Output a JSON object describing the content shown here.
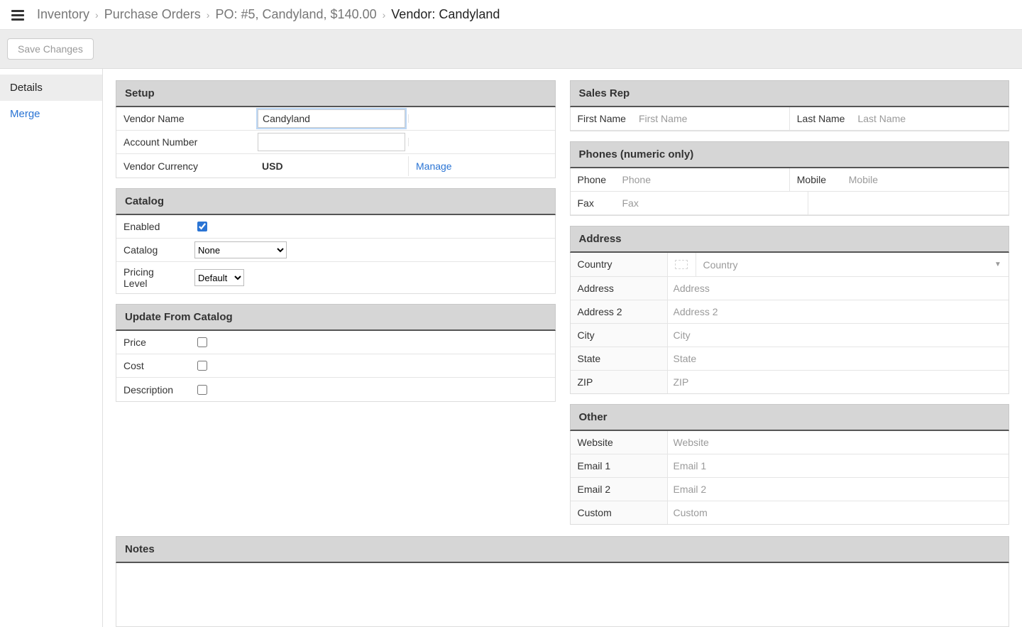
{
  "breadcrumb": {
    "items": [
      "Inventory",
      "Purchase Orders",
      "PO: #5, Candyland, $140.00",
      "Vendor: Candyland"
    ]
  },
  "toolbar": {
    "save_label": "Save Changes"
  },
  "sidebar": {
    "details": "Details",
    "merge": "Merge"
  },
  "setup": {
    "header": "Setup",
    "vendor_name_label": "Vendor Name",
    "vendor_name_value": "Candyland",
    "account_number_label": "Account Number",
    "account_number_value": "",
    "vendor_currency_label": "Vendor Currency",
    "vendor_currency_value": "USD",
    "manage_label": "Manage"
  },
  "catalog": {
    "header": "Catalog",
    "enabled_label": "Enabled",
    "enabled_value": true,
    "catalog_label": "Catalog",
    "catalog_value": "None",
    "pricing_label": "Pricing Level",
    "pricing_value": "Default"
  },
  "update": {
    "header": "Update From Catalog",
    "price_label": "Price",
    "cost_label": "Cost",
    "description_label": "Description"
  },
  "salesrep": {
    "header": "Sales Rep",
    "first_label": "First Name",
    "first_placeholder": "First Name",
    "last_label": "Last Name",
    "last_placeholder": "Last Name"
  },
  "phones": {
    "header": "Phones (numeric only)",
    "phone_label": "Phone",
    "phone_placeholder": "Phone",
    "mobile_label": "Mobile",
    "mobile_placeholder": "Mobile",
    "fax_label": "Fax",
    "fax_placeholder": "Fax"
  },
  "address": {
    "header": "Address",
    "country_label": "Country",
    "country_placeholder": "Country",
    "address_label": "Address",
    "address_placeholder": "Address",
    "address2_label": "Address 2",
    "address2_placeholder": "Address 2",
    "city_label": "City",
    "city_placeholder": "City",
    "state_label": "State",
    "state_placeholder": "State",
    "zip_label": "ZIP",
    "zip_placeholder": "ZIP"
  },
  "other": {
    "header": "Other",
    "website_label": "Website",
    "website_placeholder": "Website",
    "email1_label": "Email 1",
    "email1_placeholder": "Email 1",
    "email2_label": "Email 2",
    "email2_placeholder": "Email 2",
    "custom_label": "Custom",
    "custom_placeholder": "Custom"
  },
  "notes": {
    "header": "Notes"
  }
}
